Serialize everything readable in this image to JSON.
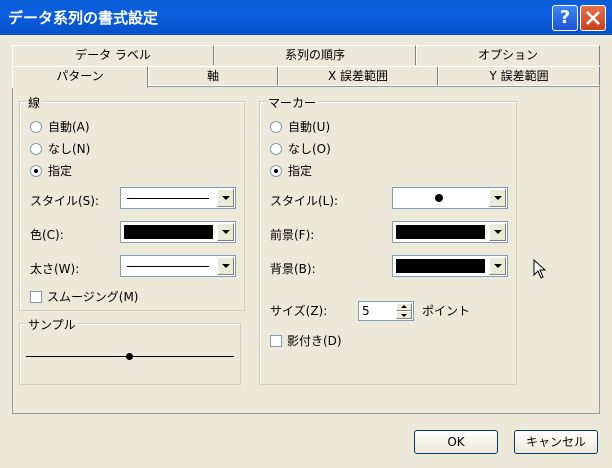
{
  "window": {
    "title": "データ系列の書式設定"
  },
  "tabs_back": [
    {
      "label": "データ ラベル"
    },
    {
      "label": "系列の順序"
    },
    {
      "label": "オプション"
    }
  ],
  "tabs_front": [
    {
      "label": "パターン"
    },
    {
      "label": "軸"
    },
    {
      "label": "X 誤差範囲"
    },
    {
      "label": "Y 誤差範囲"
    }
  ],
  "line_group": {
    "title": "線",
    "radio_auto": "自動(A)",
    "radio_none": "なし(N)",
    "radio_custom": "指定",
    "style_label": "スタイル(S):",
    "color_label": "色(C):",
    "weight_label": "太さ(W):",
    "smoothing_label": "スムージング(M)"
  },
  "sample_group": {
    "title": "サンプル"
  },
  "marker_group": {
    "title": "マーカー",
    "radio_auto": "自動(U)",
    "radio_none": "なし(O)",
    "radio_custom": "指定",
    "style_label": "スタイル(L):",
    "foreground_label": "前景(F):",
    "background_label": "背景(B):",
    "size_label": "サイズ(Z):",
    "size_value": "5",
    "size_unit": "ポイント",
    "shadow_label": "影付き(D)"
  },
  "buttons": {
    "ok": "OK",
    "cancel": "キャンセル"
  },
  "colors": {
    "line_color": "#000000",
    "foreground": "#000000",
    "background": "#000000"
  }
}
